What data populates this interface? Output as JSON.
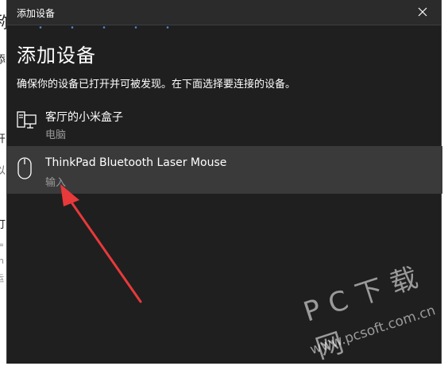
{
  "background": {
    "fragments": [
      "称",
      "添",
      "开",
      "以",
      "打",
      "=",
      "n",
      "运"
    ]
  },
  "dialog": {
    "title": "添加设备",
    "heading": "添加设备",
    "instruction": "确保你的设备已打开并可被发现。在下面选择要连接的设备。",
    "devices": [
      {
        "name": "客厅的小米盒子",
        "type": "电脑",
        "icon": "computer-icon"
      },
      {
        "name": "ThinkPad Bluetooth Laser Mouse",
        "type": "输入",
        "icon": "mouse-icon",
        "selected": true
      }
    ]
  },
  "annotation": {
    "color": "#e8393b"
  },
  "watermark": {
    "brand": "PC下载网",
    "url": "www.pcsoft.com.cn"
  }
}
